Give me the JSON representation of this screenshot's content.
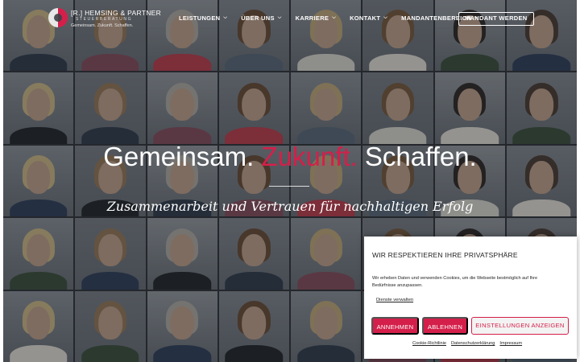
{
  "header": {
    "logo": {
      "name": "[R.] HEMSING & PARTNER",
      "subtitle": "STEUERBERATUNG",
      "tagline": "Gemeinsam. Zukunft. Schaffen."
    },
    "nav": [
      {
        "label": "LEISTUNGEN",
        "has_dropdown": true
      },
      {
        "label": "ÜBER UNS",
        "has_dropdown": true
      },
      {
        "label": "KARRIERE",
        "has_dropdown": true
      },
      {
        "label": "KONTAKT",
        "has_dropdown": true
      },
      {
        "label": "MANDANTENBEREICH",
        "has_dropdown": true
      }
    ],
    "cta_label": "MANDANT WERDEN"
  },
  "hero": {
    "headline_part1": "Gemeinsam.",
    "headline_accent": "Zukunft.",
    "headline_part2": "Schaffen.",
    "subline": "Zusammenarbeit und Vertrauen für nachhaltigen Erfolg",
    "photo_grid": {
      "columns": 8,
      "rows": 5
    }
  },
  "cookie_banner": {
    "title": "WIR RESPEKTIEREN IHRE PRIVATSPHÄRE",
    "text": "Wir erheben Daten und verwenden Cookies, um die Webseite bestmöglich auf Ihre Bedürfnisse anzupassen.",
    "manage_link": "Dienste verwalten",
    "accept_label": "ANNEHMEN",
    "deny_label": "ABLEHNEN",
    "settings_label": "EINSTELLUNGEN ANZEIGEN",
    "footer_links": [
      "Cookie-Richtlinie",
      "Datenschutzerklärung",
      "Impressum"
    ]
  },
  "colors": {
    "accent": "#d41f4a",
    "overlay": "#191c22",
    "text_light": "#ffffff",
    "banner_bg": "#ffffff"
  },
  "icons": {
    "dropdown": "chevron-down-icon",
    "logo": "logo-mark-icon"
  }
}
